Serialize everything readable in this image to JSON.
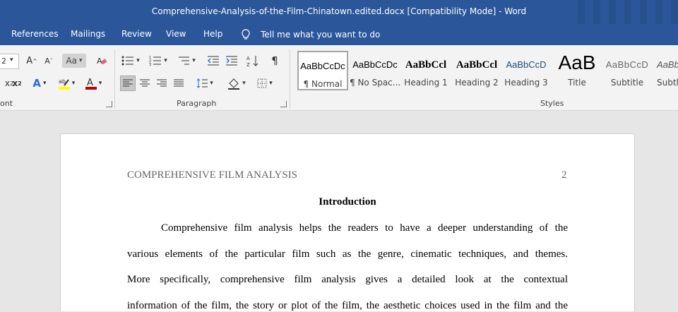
{
  "window": {
    "title": "Comprehensive-Analysis-of-the-Film-Chinatown.edited.docx [Compatibility Mode]  -  Word"
  },
  "menu": {
    "tabs": [
      "References",
      "Mailings",
      "Review",
      "View",
      "Help"
    ],
    "tell_me": "Tell me what you want to do"
  },
  "ribbon": {
    "font_size_value": "2",
    "change_case_label": "Aa",
    "font_group_label": "ont",
    "paragraph_group_label": "Paragraph",
    "styles_group_label": "Styles",
    "styles": [
      {
        "preview": "AaBbCcDc",
        "name": "¶ Normal"
      },
      {
        "preview": "AaBbCcDc",
        "name": "¶ No Spac..."
      },
      {
        "preview": "AaBbCcl",
        "name": "Heading 1"
      },
      {
        "preview": "AaBbCcl",
        "name": "Heading 2"
      },
      {
        "preview": "AaBbCcD",
        "name": "Heading 3"
      },
      {
        "preview": "AaB",
        "name": "Title"
      },
      {
        "preview": "AaBbCcD",
        "name": "Subtitle"
      },
      {
        "preview": "AaBb",
        "name": "Subtle"
      }
    ],
    "accent_colors": {
      "highlight": "#ffff00",
      "font_color": "#c00000"
    }
  },
  "document": {
    "header_left": "COMPREHENSIVE FILM ANALYSIS",
    "page_number": "2",
    "heading": "Introduction",
    "lines": [
      "Comprehensive film analysis helps the readers to have a deeper understanding of the",
      "various elements of the particular film such as the genre, cinematic techniques, and themes.",
      "More specifically, comprehensive film analysis gives a detailed look at the contextual",
      "information of the film, the story or plot of the film, the aesthetic choices used in the film and the"
    ]
  }
}
